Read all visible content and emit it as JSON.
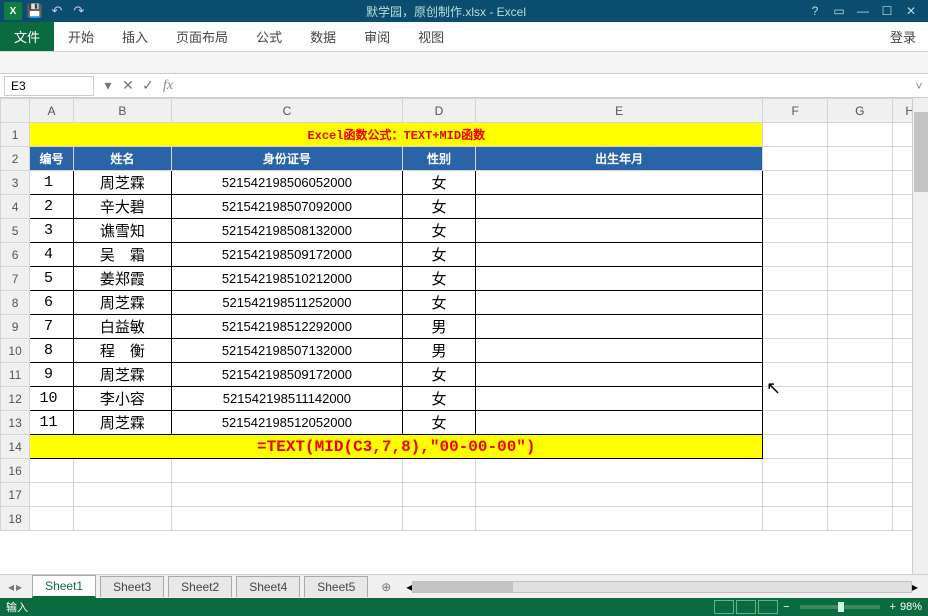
{
  "window": {
    "title": "默学园，原创制作.xlsx - Excel",
    "login": "登录"
  },
  "qat": {
    "save": "💾",
    "undo": "↶",
    "redo": "↷"
  },
  "winctrl": {
    "help": "?",
    "ropt": "▭",
    "min": "—",
    "max": "☐",
    "close": "✕"
  },
  "ribbon": {
    "file": "文件",
    "tabs": [
      "开始",
      "插入",
      "页面布局",
      "公式",
      "数据",
      "审阅",
      "视图"
    ]
  },
  "fbar": {
    "namebox": "E3",
    "dropdown": "▾",
    "cancel": "✕",
    "enter": "✓",
    "fx": "fx",
    "formula": "",
    "expand": "˅"
  },
  "cols": [
    "A",
    "B",
    "C",
    "D",
    "E",
    "F",
    "G",
    "H"
  ],
  "row1_title": "Excel函数公式：TEXT+MID函数",
  "headers": {
    "a": "编号",
    "b": "姓名",
    "c": "身份证号",
    "d": "性别",
    "e": "出生年月"
  },
  "rows": [
    {
      "r": 3,
      "n": "1",
      "name": "周芝霖",
      "id": "521542198506052000",
      "sex": "女"
    },
    {
      "r": 4,
      "n": "2",
      "name": "辛大碧",
      "id": "521542198507092000",
      "sex": "女"
    },
    {
      "r": 5,
      "n": "3",
      "name": "谯雪知",
      "id": "521542198508132000",
      "sex": "女"
    },
    {
      "r": 6,
      "n": "4",
      "name": "吴　霜",
      "id": "521542198509172000",
      "sex": "女"
    },
    {
      "r": 7,
      "n": "5",
      "name": "姜郑霞",
      "id": "521542198510212000",
      "sex": "女"
    },
    {
      "r": 8,
      "n": "6",
      "name": "周芝霖",
      "id": "521542198511252000",
      "sex": "女"
    },
    {
      "r": 9,
      "n": "7",
      "name": "白益敏",
      "id": "521542198512292000",
      "sex": "男"
    },
    {
      "r": 10,
      "n": "8",
      "name": "程　衡",
      "id": "521542198507132000",
      "sex": "男"
    },
    {
      "r": 11,
      "n": "9",
      "name": "周芝霖",
      "id": "521542198509172000",
      "sex": "女"
    },
    {
      "r": 12,
      "n": "10",
      "name": "李小容",
      "id": "521542198511142000",
      "sex": "女"
    },
    {
      "r": 13,
      "n": "11",
      "name": "周芝霖",
      "id": "521542198512052000",
      "sex": "女"
    }
  ],
  "formula_row": {
    "r": 14,
    "text": "=TEXT(MID(C3,7,8),\"00-00-00\")"
  },
  "empty_rows": [
    16,
    17,
    18
  ],
  "sheets": {
    "active": "Sheet1",
    "others": [
      "Sheet3",
      "Sheet2",
      "Sheet4",
      "Sheet5"
    ],
    "add": "⊕",
    "nav_prev": "◂",
    "nav_next": "▸"
  },
  "status": {
    "mode": "输入",
    "zoom": "98%",
    "minus": "−",
    "plus": "+"
  }
}
